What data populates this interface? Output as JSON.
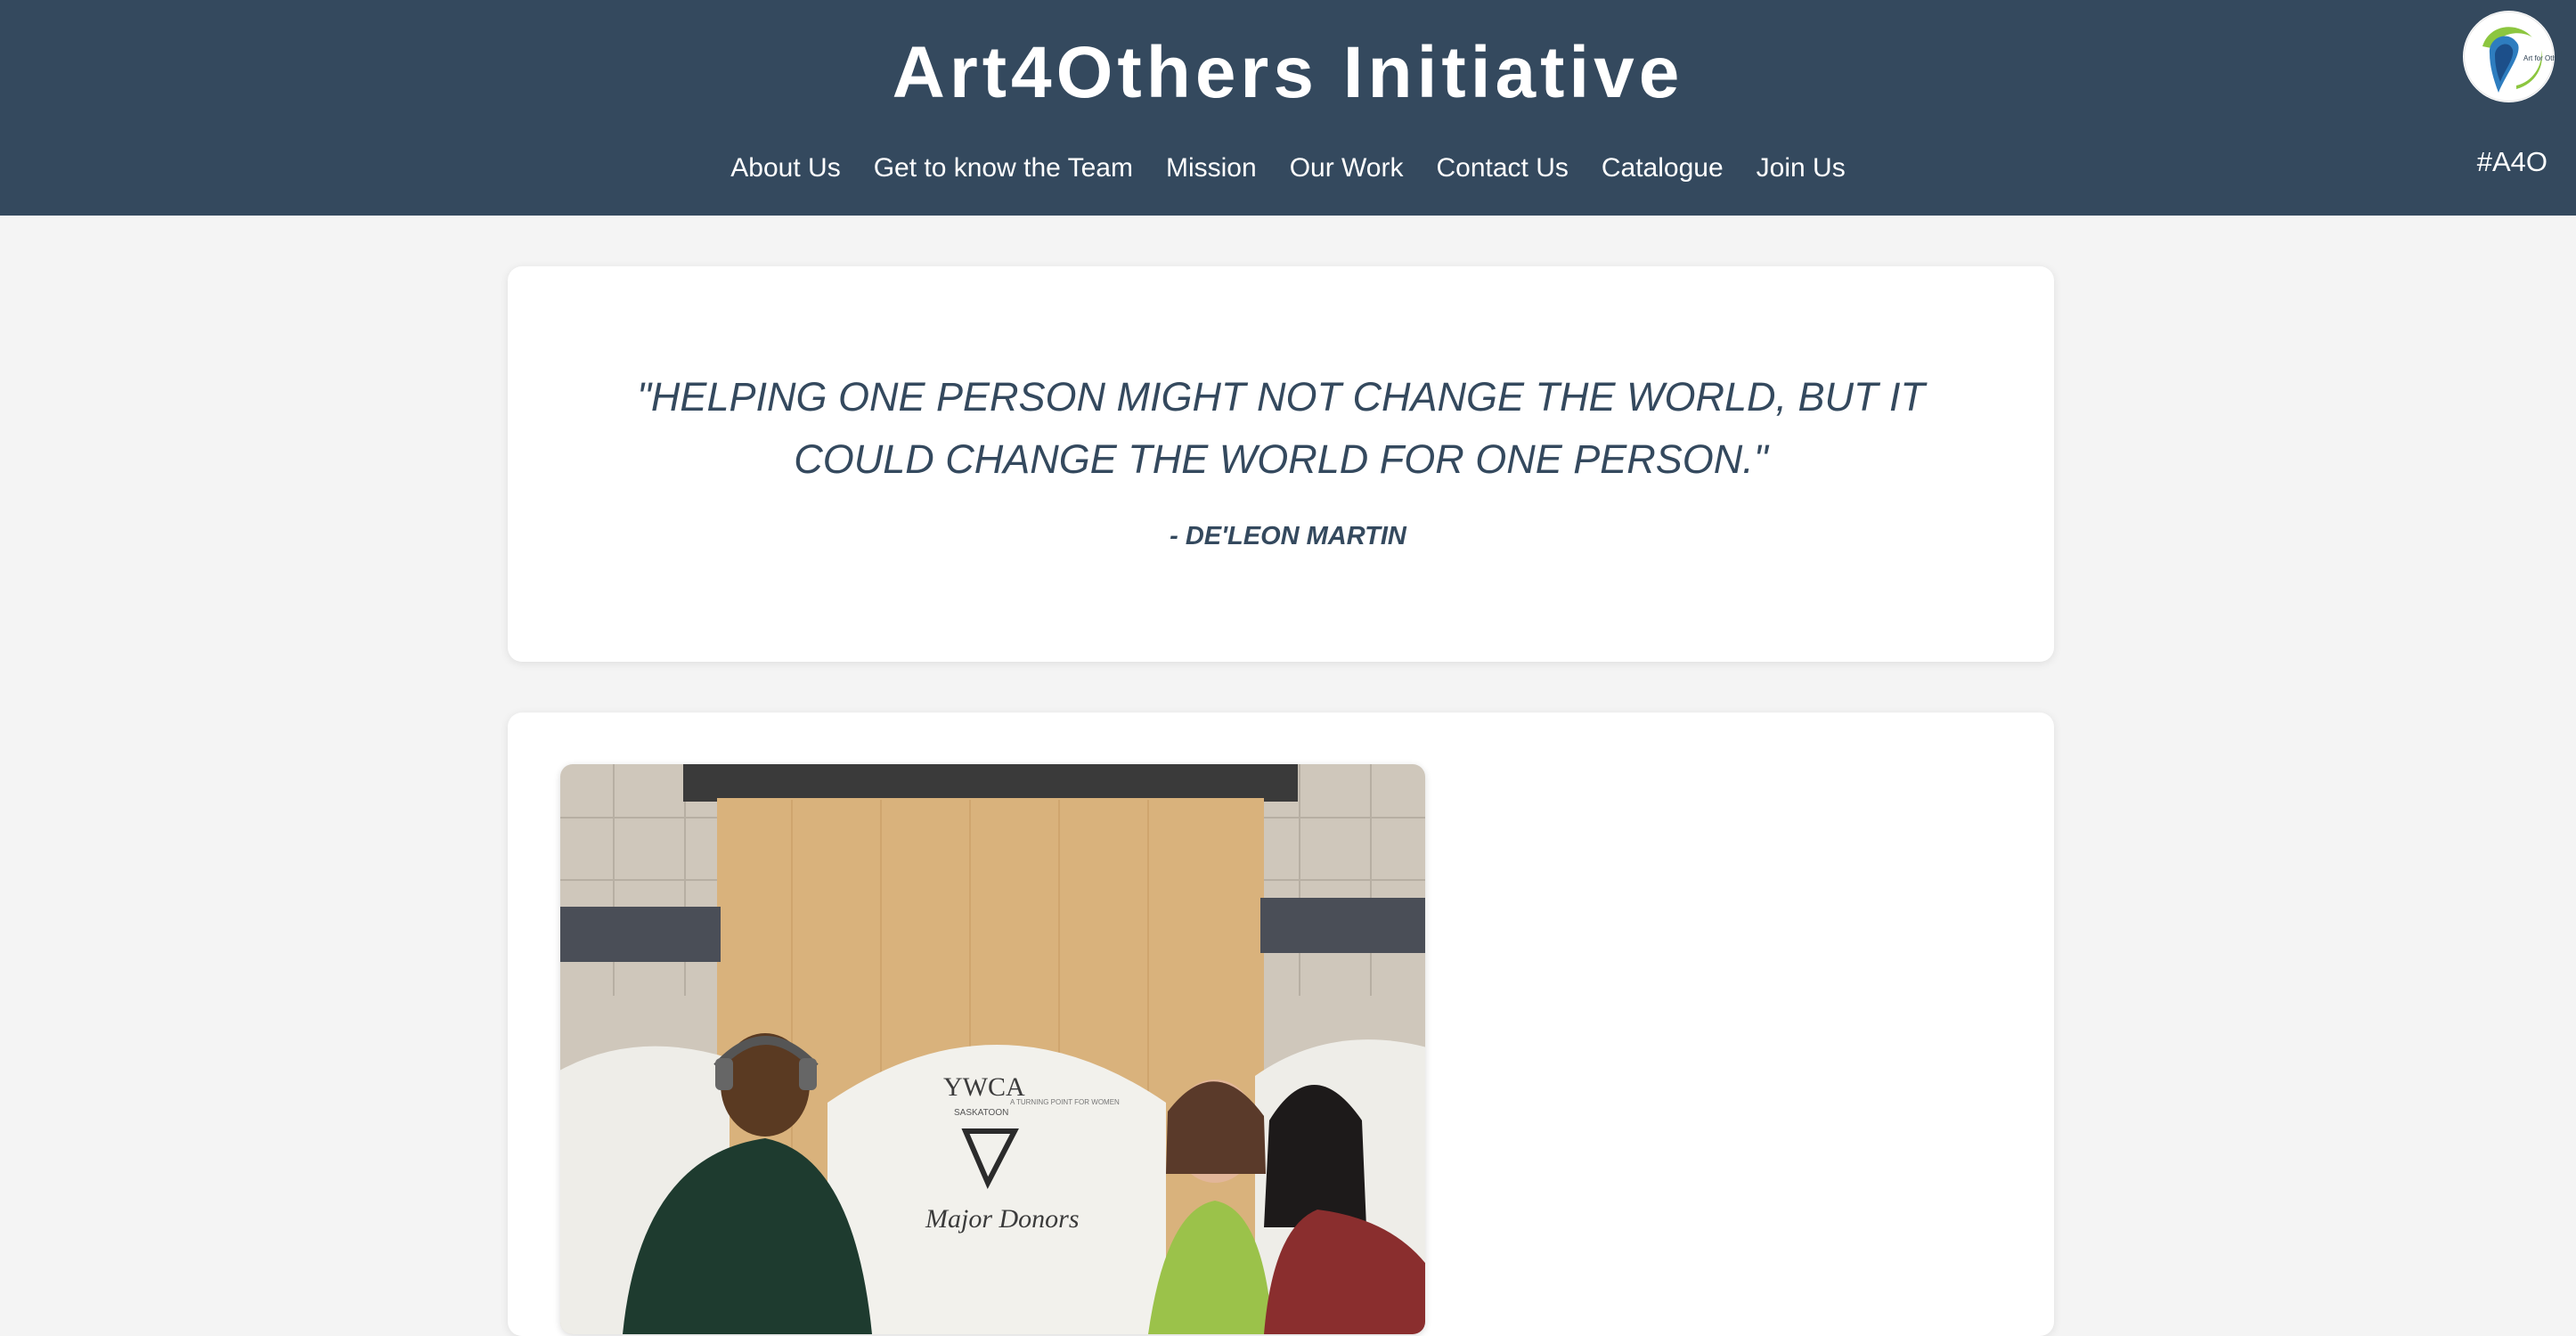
{
  "header": {
    "title": "Art4Others Initiative",
    "hashtag": "#A4O",
    "logo_icon": "art-for-others-logo",
    "logo_text": "Art for Others",
    "nav": [
      {
        "label": "About Us"
      },
      {
        "label": "Get to know the Team"
      },
      {
        "label": "Mission"
      },
      {
        "label": "Our Work"
      },
      {
        "label": "Contact Us"
      },
      {
        "label": "Catalogue"
      },
      {
        "label": "Join Us"
      }
    ]
  },
  "quote": {
    "text": "\"Helping one person might not change the world, but it could change the world for one person.\"",
    "author": "- De'Leon Martin"
  },
  "photo": {
    "signage": {
      "org": "YWCA",
      "city": "SASKATOON",
      "tagline": "A TURNING POINT FOR WOMEN",
      "donors": "Major Donors"
    }
  },
  "colors": {
    "header_bg": "#34495e",
    "page_bg": "#f4f4f4",
    "card_bg": "#ffffff",
    "quote_text": "#34495e"
  }
}
